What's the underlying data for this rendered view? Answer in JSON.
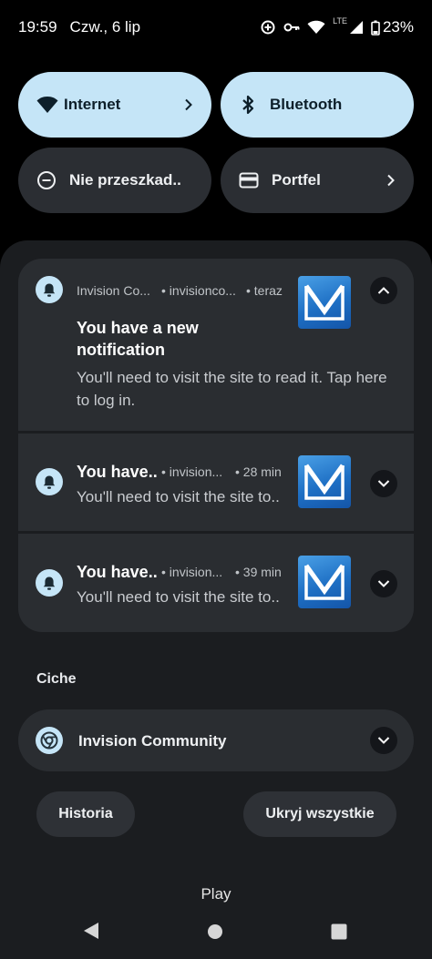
{
  "status_bar": {
    "time": "19:59",
    "date": "Czw., 6 lip",
    "network_type": "LTE",
    "battery": "23%",
    "icons": [
      "data-saver-icon",
      "vpn-key-icon",
      "wifi-icon",
      "cellular-signal-icon",
      "battery-icon"
    ]
  },
  "quick_settings": {
    "tiles": [
      {
        "label": "Internet",
        "icon": "wifi-icon",
        "state": "on",
        "has_chevron": true
      },
      {
        "label": "Bluetooth",
        "icon": "bluetooth-icon",
        "state": "on",
        "has_chevron": false
      },
      {
        "label": "Nie przeszkad..",
        "icon": "do-not-disturb-icon",
        "state": "off",
        "has_chevron": false
      },
      {
        "label": "Portfel",
        "icon": "wallet-icon",
        "state": "off",
        "has_chevron": true
      }
    ]
  },
  "notifications": [
    {
      "app": "Invision Co...",
      "source": "• invisionco...",
      "time": "• teraz",
      "title": "You have a new notification",
      "body": "You'll need to visit the site to read it. Tap here to log in.",
      "expanded": true
    },
    {
      "app": "",
      "source": "• invision...",
      "time": "• 28 min",
      "title": "You have..",
      "body": "You'll need to visit the site to..",
      "expanded": false
    },
    {
      "app": "",
      "source": "• invision...",
      "time": "• 39 min",
      "title": "You have..",
      "body": "You'll need to visit the site to..",
      "expanded": false
    }
  ],
  "silent_section": {
    "label": "Ciche",
    "item": {
      "title": "Invision Community",
      "icon": "chrome-icon"
    }
  },
  "actions": {
    "history": "Historia",
    "dismiss_all": "Ukryj wszystkie"
  },
  "footer": {
    "carrier": "Play"
  },
  "navigation": [
    "back-icon",
    "home-icon",
    "recents-icon"
  ],
  "colors": {
    "tile_on": "#c5e5f7",
    "tile_off": "#2b2e33",
    "card": "#2a2d31",
    "shade": "#1b1d20"
  }
}
